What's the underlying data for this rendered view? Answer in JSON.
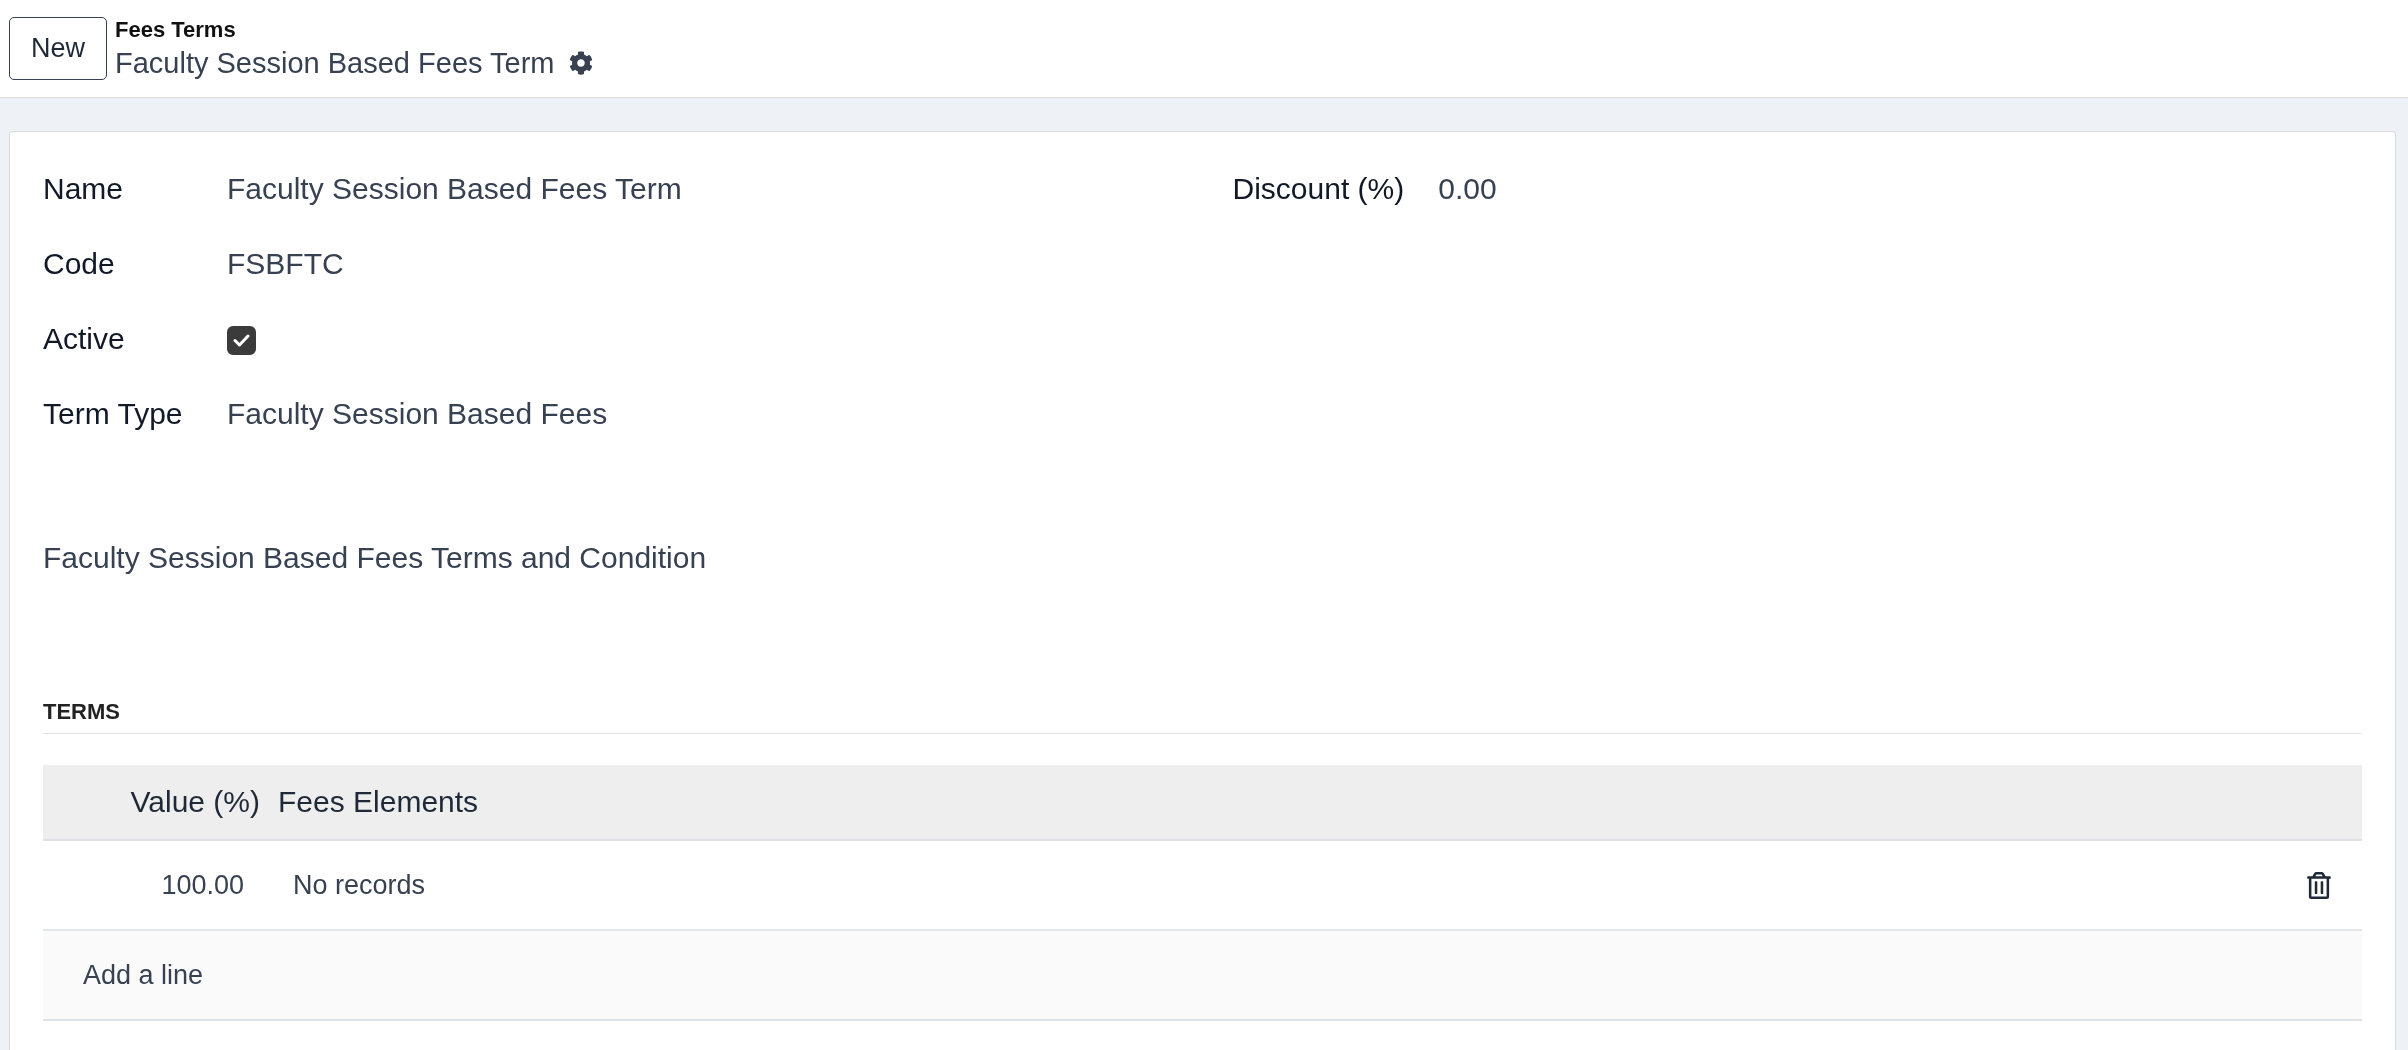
{
  "control_panel": {
    "new_button": "New",
    "breadcrumb": "Fees Terms",
    "title": "Faculty Session Based Fees Term"
  },
  "form": {
    "left_fields": [
      {
        "label": "Name",
        "kind": "text",
        "value": "Faculty Session Based Fees Term"
      },
      {
        "label": "Code",
        "kind": "text",
        "value": "FSBFTC"
      },
      {
        "label": "Active",
        "kind": "checkbox",
        "checked": true
      },
      {
        "label": "Term Type",
        "kind": "text",
        "value": "Faculty Session Based Fees"
      }
    ],
    "right_fields": [
      {
        "label": "Discount (%)",
        "kind": "text",
        "value": "0.00"
      }
    ],
    "note": "Faculty Session Based Fees Terms and Condition"
  },
  "terms": {
    "title": "TERMS",
    "columns": [
      "Value (%)",
      "Fees Elements"
    ],
    "rows": [
      {
        "cells": [
          "100.00",
          "No records"
        ]
      }
    ],
    "add_line": "Add a line"
  }
}
